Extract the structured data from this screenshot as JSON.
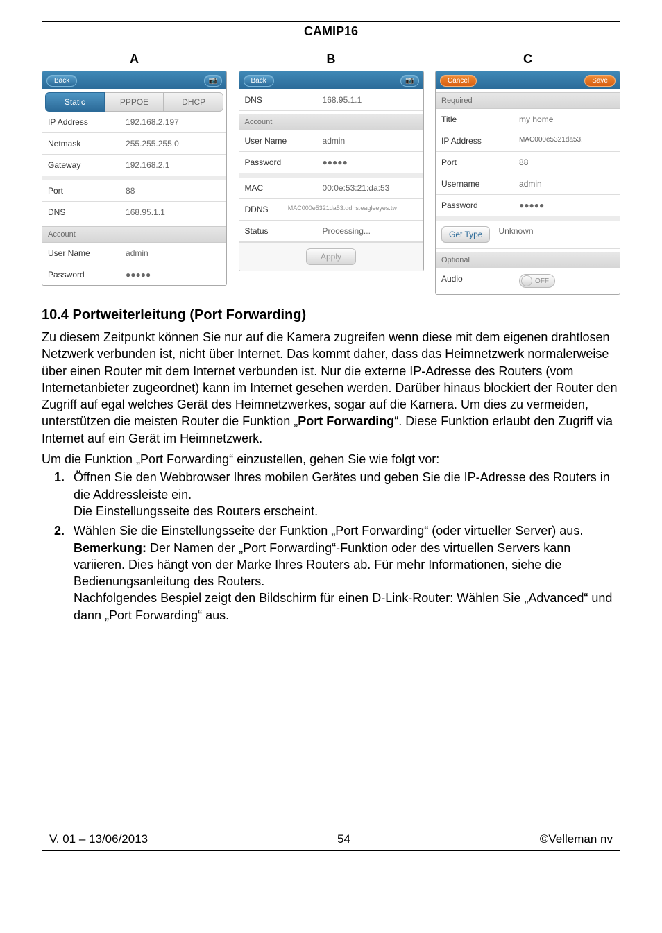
{
  "header": {
    "title": "CAMIP16"
  },
  "columns": {
    "a": {
      "label": "A"
    },
    "b": {
      "label": "B"
    },
    "c": {
      "label": "C"
    }
  },
  "panelA": {
    "top": {
      "back": "Back",
      "logo": "📷"
    },
    "tabs": {
      "static": "Static",
      "pppoe": "PPPOE",
      "dhcp": "DHCP"
    },
    "rows": {
      "ip": {
        "k": "IP Address",
        "v": "192.168.2.197"
      },
      "netmask": {
        "k": "Netmask",
        "v": "255.255.255.0"
      },
      "gateway": {
        "k": "Gateway",
        "v": "192.168.2.1"
      },
      "port": {
        "k": "Port",
        "v": "88"
      },
      "dns": {
        "k": "DNS",
        "v": "168.95.1.1"
      }
    },
    "account_hdr": "Account",
    "acct": {
      "user": {
        "k": "User Name",
        "v": "admin"
      },
      "pass": {
        "k": "Password",
        "v": "●●●●●"
      }
    }
  },
  "panelB": {
    "top": {
      "back": "Back",
      "logo": "📷"
    },
    "rows": {
      "dns": {
        "k": "DNS",
        "v": "168.95.1.1"
      }
    },
    "account_hdr": "Account",
    "acct": {
      "user": {
        "k": "User Name",
        "v": "admin"
      },
      "pass": {
        "k": "Password",
        "v": "●●●●●"
      }
    },
    "mac": {
      "k": "MAC",
      "v": "00:0e:53:21:da:53"
    },
    "ddns": {
      "k": "DDNS",
      "v": "MAC000e5321da53.ddns.eagleeyes.tw"
    },
    "status": {
      "k": "Status",
      "v": "Processing..."
    },
    "apply": "Apply"
  },
  "panelC": {
    "top": {
      "cancel": "Cancel",
      "save": "Save"
    },
    "req_hdr": "Required",
    "required": {
      "title": {
        "k": "Title",
        "v": "my home"
      },
      "ip": {
        "k": "IP Address",
        "v": "MAC000e5321da53."
      },
      "port": {
        "k": "Port",
        "v": "88"
      },
      "user": {
        "k": "Username",
        "v": "admin"
      },
      "pass": {
        "k": "Password",
        "v": "●●●●●"
      }
    },
    "gettype": {
      "btn": "Get Type",
      "val": "Unknown"
    },
    "opt_hdr": "Optional",
    "optional": {
      "audio": {
        "k": "Audio",
        "v": "OFF"
      }
    }
  },
  "section": {
    "num_title": "10.4   Portweiterleitung (Port Forwarding)",
    "para1a": "Zu diesem Zeitpunkt können Sie nur auf die Kamera zugreifen wenn diese mit dem eigenen drahtlosen Netzwerk verbunden ist, nicht über Internet. Das kommt daher, dass das Heimnetzwerk normalerweise über einen Router mit dem Internet verbunden ist. Nur die externe IP-Adresse des Routers (vom Internetanbieter zugeordnet) kann im Internet gesehen werden. Darüber hinaus blockiert der Router den Zugriff auf egal welches Gerät des Heimnetzwerkes, sogar auf die Kamera. Um dies zu vermeiden, unterstützen die meisten Router die Funktion „",
    "pf_bold": "Port Forwarding",
    "para1b": "“. Diese Funktion erlaubt den Zugriff via Internet auf ein Gerät im Heimnetzwerk.",
    "para2": "Um die Funktion „Port Forwarding“ einzustellen, gehen Sie wie folgt vor:",
    "li1a": "Öffnen Sie den Webbrowser Ihres mobilen Gerätes und geben Sie die IP-Adresse des Routers in die Addressleiste ein.",
    "li1b": "Die Einstellungsseite des Routers erscheint.",
    "li2a": "Wählen Sie die Einstellungsseite der Funktion „Port Forwarding“ (oder virtueller Server) aus.",
    "li2_bem_label": "Bemerkung:",
    "li2b": " Der Namen der „Port Forwarding“-Funktion oder des virtuellen Servers kann variieren. Dies hängt von der Marke Ihres Routers ab. Für mehr Informationen, siehe die Bedienungsanleitung des Routers.",
    "li2c": "Nachfolgendes Bespiel zeigt den Bildschirm für einen D-Link-Router: Wählen Sie „Advanced“ und dann „Port Forwarding“ aus."
  },
  "footer": {
    "left": "V. 01 – 13/06/2013",
    "center": "54",
    "right": "©Velleman nv"
  }
}
